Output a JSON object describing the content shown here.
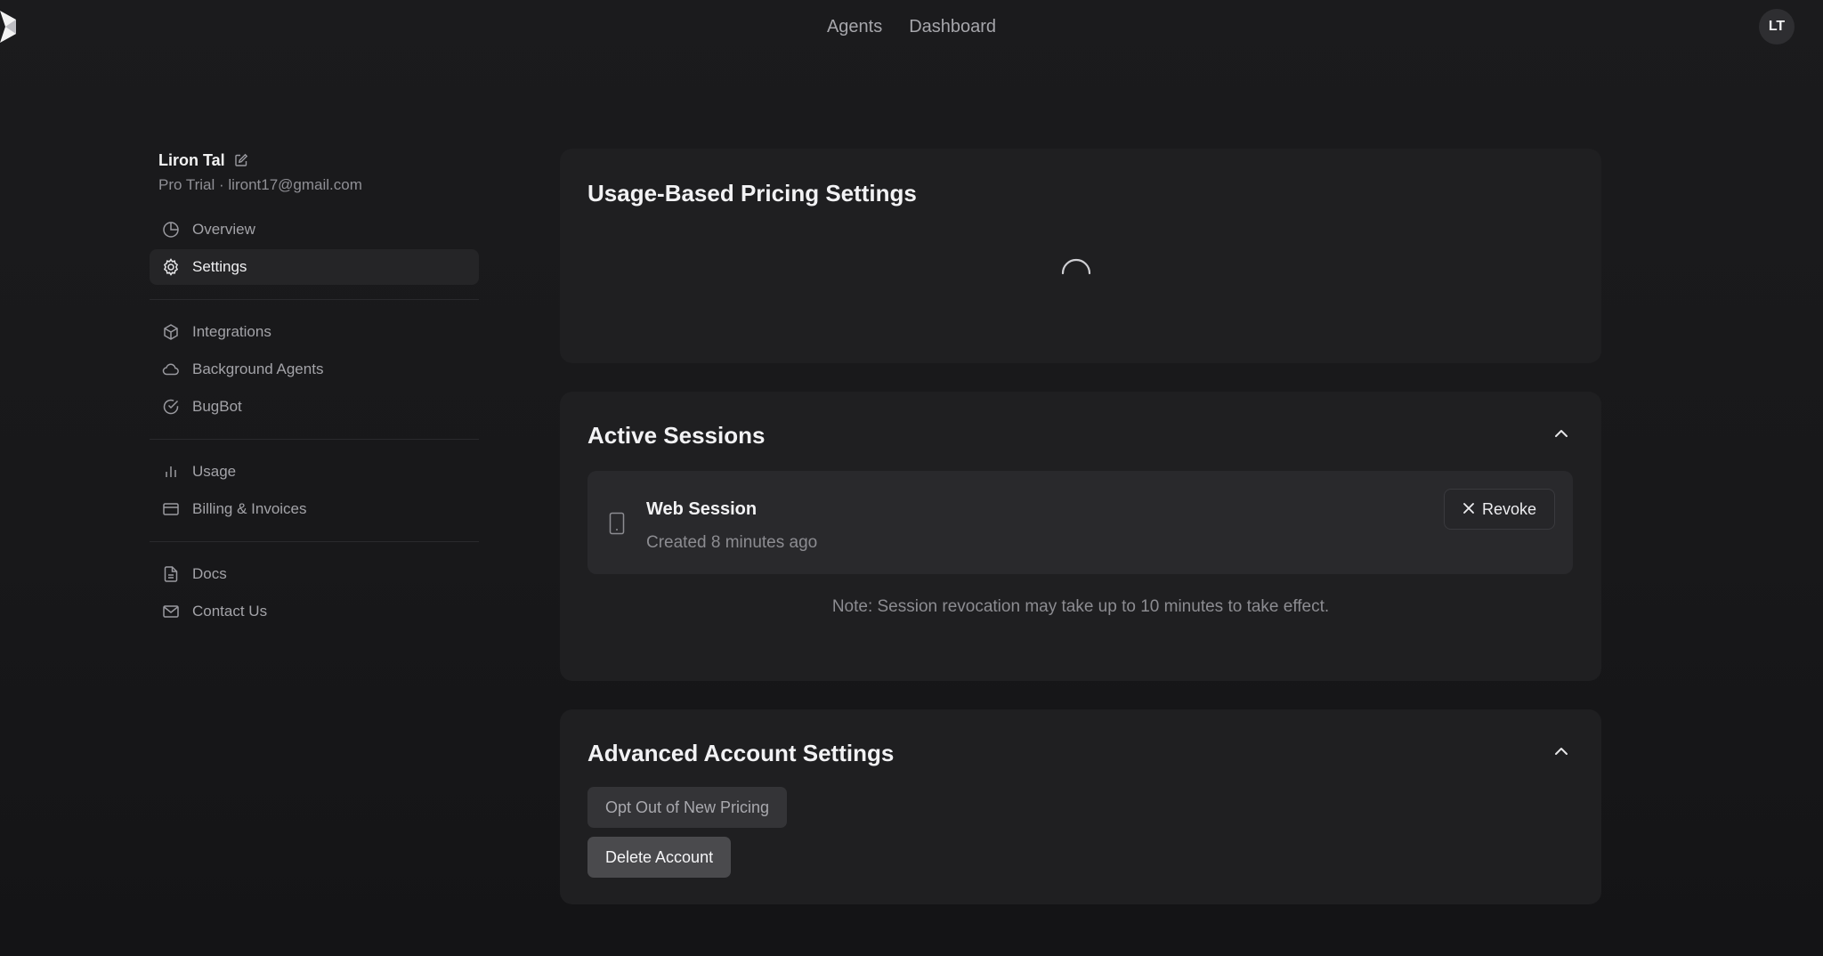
{
  "nav": {
    "links": [
      "Agents",
      "Dashboard"
    ],
    "avatar_initials": "LT"
  },
  "profile": {
    "name": "Liron Tal",
    "subtitle": "Pro Trial · liront17@gmail.com"
  },
  "sidebar": {
    "groups": [
      [
        {
          "label": "Overview",
          "icon": "pie-chart-icon",
          "active": false
        },
        {
          "label": "Settings",
          "icon": "gear-icon",
          "active": true
        }
      ],
      [
        {
          "label": "Integrations",
          "icon": "box-icon",
          "active": false
        },
        {
          "label": "Background Agents",
          "icon": "cloud-icon",
          "active": false
        },
        {
          "label": "BugBot",
          "icon": "check-circle-icon",
          "active": false
        }
      ],
      [
        {
          "label": "Usage",
          "icon": "bar-chart-icon",
          "active": false
        },
        {
          "label": "Billing & Invoices",
          "icon": "credit-card-icon",
          "active": false
        }
      ],
      [
        {
          "label": "Docs",
          "icon": "document-icon",
          "active": false
        },
        {
          "label": "Contact Us",
          "icon": "mail-icon",
          "active": false
        }
      ]
    ]
  },
  "usage_pricing": {
    "title": "Usage-Based Pricing Settings"
  },
  "sessions": {
    "title": "Active Sessions",
    "items": [
      {
        "title": "Web Session",
        "created": "Created 8 minutes ago",
        "revoke_label": "Revoke"
      }
    ],
    "note": "Note: Session revocation may take up to 10 minutes to take effect."
  },
  "advanced": {
    "title": "Advanced Account Settings",
    "opt_out_label": "Opt Out of New Pricing",
    "delete_label": "Delete Account"
  },
  "colors": {
    "background": "#18181a",
    "card": "#1f1f21",
    "active_item": "#252527"
  }
}
